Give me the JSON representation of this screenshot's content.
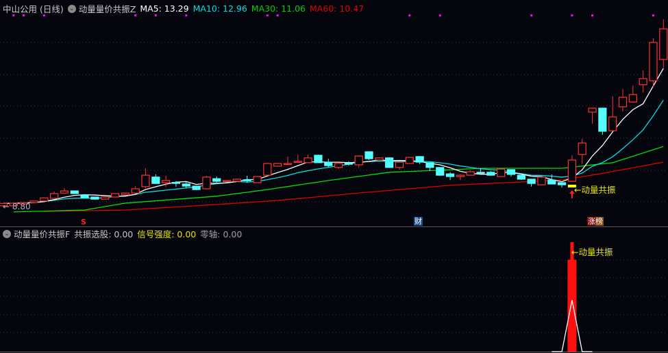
{
  "header": {
    "stock": "中山公用 (日线)",
    "indicator": "动量量价共振Z",
    "ma5_label": "MA5: 13.29",
    "ma10_label": "MA10: 12.96",
    "ma30_label": "MA30: 11.06",
    "ma60_label": "MA60: 10.47"
  },
  "sub_header": {
    "indicator": "动量量价共振F",
    "resonance_label": "共振选股: 0.00",
    "strength_label": "信号强度: 0.00",
    "zero_label": "零轴: 0.00"
  },
  "annotations": {
    "low_price": "← 8.80",
    "signal_main": "←动量共振",
    "signal_sub": "←动量共振",
    "marker_s": "S",
    "marker_cai": "财",
    "marker_zhangbang": "涨榜"
  },
  "colors": {
    "up": "#ff3232",
    "down": "#54ffff",
    "ma5": "#ffffff",
    "ma10": "#00e0e0",
    "ma30": "#00e000",
    "ma60": "#e00000",
    "marker": "#ff00ff",
    "signal": "#ffff00"
  },
  "chart_data": {
    "type": "candlestick",
    "title": "中山公用 (日线)",
    "price_range": [
      8.6,
      15.9
    ],
    "low_marker": 8.8,
    "ohlc": [
      [
        8.83,
        8.93,
        8.8,
        8.92
      ],
      [
        8.83,
        8.95,
        8.82,
        8.93
      ],
      [
        8.9,
        8.97,
        8.89,
        8.95
      ],
      [
        8.95,
        9.02,
        8.94,
        9.01
      ],
      [
        9.01,
        9.14,
        9.0,
        9.13
      ],
      [
        9.11,
        9.37,
        9.1,
        9.29
      ],
      [
        9.31,
        9.49,
        9.29,
        9.39
      ],
      [
        9.39,
        9.4,
        9.28,
        9.29
      ],
      [
        9.24,
        9.26,
        9.12,
        9.13
      ],
      [
        9.16,
        9.17,
        9.06,
        9.08
      ],
      [
        9.08,
        9.17,
        9.07,
        9.16
      ],
      [
        9.16,
        9.3,
        9.15,
        9.29
      ],
      [
        9.24,
        9.33,
        9.23,
        9.31
      ],
      [
        9.31,
        9.57,
        9.3,
        9.47
      ],
      [
        9.55,
        10.24,
        9.49,
        9.98
      ],
      [
        9.91,
        10.01,
        9.65,
        9.67
      ],
      [
        9.7,
        9.96,
        9.55,
        9.78
      ],
      [
        9.71,
        9.75,
        9.55,
        9.7
      ],
      [
        9.65,
        9.73,
        9.49,
        9.57
      ],
      [
        9.57,
        9.58,
        9.42,
        9.44
      ],
      [
        9.47,
        9.96,
        9.44,
        9.91
      ],
      [
        9.85,
        9.93,
        9.7,
        9.75
      ],
      [
        9.75,
        9.8,
        9.74,
        9.78
      ],
      [
        9.75,
        9.85,
        9.73,
        9.83
      ],
      [
        9.81,
        9.96,
        9.7,
        9.8
      ],
      [
        9.7,
        9.95,
        9.69,
        9.93
      ],
      [
        9.98,
        10.45,
        9.97,
        10.42
      ],
      [
        10.32,
        10.44,
        10.3,
        10.42
      ],
      [
        10.4,
        10.68,
        10.39,
        10.42
      ],
      [
        10.47,
        10.75,
        10.46,
        10.5
      ],
      [
        10.45,
        10.75,
        10.44,
        10.63
      ],
      [
        10.73,
        10.75,
        10.44,
        10.45
      ],
      [
        10.47,
        10.6,
        10.27,
        10.34
      ],
      [
        10.27,
        10.43,
        10.21,
        10.42
      ],
      [
        10.43,
        10.5,
        10.34,
        10.42
      ],
      [
        10.37,
        10.73,
        10.27,
        10.7
      ],
      [
        10.86,
        10.87,
        10.55,
        10.6
      ],
      [
        10.55,
        10.65,
        10.54,
        10.63
      ],
      [
        10.63,
        10.65,
        10.26,
        10.27
      ],
      [
        10.27,
        10.48,
        10.19,
        10.47
      ],
      [
        10.42,
        10.67,
        10.41,
        10.65
      ],
      [
        10.68,
        10.7,
        10.39,
        10.47
      ],
      [
        10.45,
        10.46,
        10.14,
        10.27
      ],
      [
        10.27,
        10.28,
        9.96,
        9.98
      ],
      [
        10.03,
        10.09,
        9.8,
        9.93
      ],
      [
        9.93,
        10.01,
        9.8,
        9.98
      ],
      [
        9.98,
        10.16,
        9.97,
        10.11
      ],
      [
        10.09,
        10.24,
        10.06,
        10.08
      ],
      [
        10.09,
        10.14,
        9.96,
        9.98
      ],
      [
        9.93,
        10.22,
        9.92,
        10.21
      ],
      [
        10.19,
        10.2,
        9.93,
        10.01
      ],
      [
        9.98,
        9.99,
        9.8,
        9.83
      ],
      [
        9.83,
        9.84,
        9.55,
        9.67
      ],
      [
        9.62,
        9.92,
        9.61,
        9.91
      ],
      [
        9.8,
        10.01,
        9.64,
        9.65
      ],
      [
        9.7,
        9.71,
        9.52,
        9.62
      ],
      [
        9.75,
        10.73,
        9.74,
        10.55
      ],
      [
        10.76,
        11.35,
        10.4,
        11.19
      ],
      [
        12.35,
        12.52,
        11.91,
        12.5
      ],
      [
        12.5,
        12.52,
        11.5,
        11.63
      ],
      [
        11.65,
        12.94,
        11.63,
        12.17
      ],
      [
        12.55,
        13.22,
        12.37,
        12.91
      ],
      [
        12.73,
        13.35,
        12.7,
        13.01
      ],
      [
        13.38,
        13.92,
        13.09,
        13.61
      ],
      [
        13.53,
        15.12,
        13.3,
        14.97
      ],
      [
        14.33,
        15.84,
        14.02,
        15.48
      ]
    ],
    "ma30_keypoints": [
      [
        1,
        8.6
      ],
      [
        8,
        8.67
      ],
      [
        12,
        8.93
      ],
      [
        21,
        9.19
      ],
      [
        26,
        9.44
      ],
      [
        32,
        9.78
      ],
      [
        38,
        10.09
      ],
      [
        45,
        10.2
      ],
      [
        47,
        10.24
      ],
      [
        55,
        10.24
      ],
      [
        60,
        10.45
      ],
      [
        65,
        11.06
      ]
    ],
    "ma60_keypoints": [
      [
        4,
        8.62
      ],
      [
        12,
        8.67
      ],
      [
        21,
        8.88
      ],
      [
        27,
        9.03
      ],
      [
        35,
        9.31
      ],
      [
        44,
        9.6
      ],
      [
        55,
        9.8
      ],
      [
        59,
        10.05
      ],
      [
        65,
        10.47
      ]
    ],
    "event_dot_indices": [
      1,
      2,
      4,
      13,
      15,
      18,
      26,
      27,
      40,
      43,
      52,
      56,
      58,
      64
    ],
    "signal_index": 56,
    "marker_indices": {
      "s": 8,
      "cai": 41,
      "zhangbang": 58
    },
    "sub_indicator": {
      "range": [
        0,
        100
      ],
      "resonance_bar": {
        "index": 56,
        "value": 84
      },
      "strength_bar": {
        "index": 56,
        "value": 100
      },
      "line": {
        "start_index": 54,
        "values": [
          0,
          0,
          47,
          0,
          0
        ]
      }
    }
  }
}
